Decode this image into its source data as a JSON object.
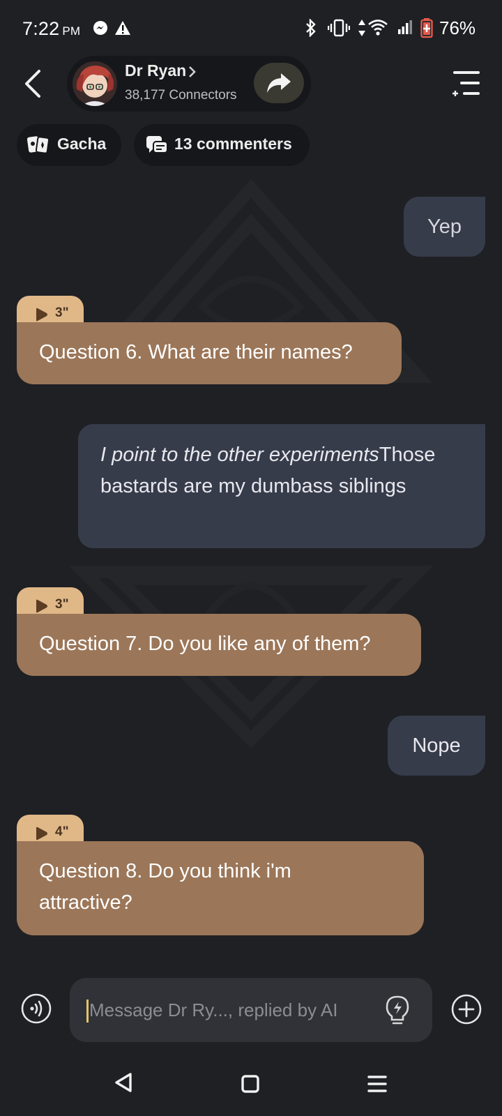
{
  "status_bar": {
    "time": "7:22",
    "ampm": "PM",
    "battery": "76%"
  },
  "header": {
    "name": "Dr Ryan",
    "subtitle": "38,177 Connectors"
  },
  "chips": {
    "gacha": "Gacha",
    "commenters": "13 commenters"
  },
  "messages": [
    {
      "role": "user",
      "text": "Yep"
    },
    {
      "role": "bot",
      "duration": "3\"",
      "text": "Question 6. What are their names?"
    },
    {
      "role": "user",
      "italic": "I point to the other experiments",
      "text": "Those bastards are my dumbass siblings"
    },
    {
      "role": "bot",
      "duration": "3\"",
      "text": "Question 7. Do you like any of them?"
    },
    {
      "role": "user",
      "text": "Nope"
    },
    {
      "role": "bot",
      "duration": "4\"",
      "text": "Question 8. Do you think i'm attractive?"
    }
  ],
  "input": {
    "placeholder": "Message Dr Ry..., replied by AI"
  },
  "colors": {
    "background": "#1f2024",
    "user_bubble": "#373c4b",
    "bot_bubble": "#9b7658",
    "voice_tag": "#e0b888",
    "accent_caret": "#e7c36a"
  }
}
